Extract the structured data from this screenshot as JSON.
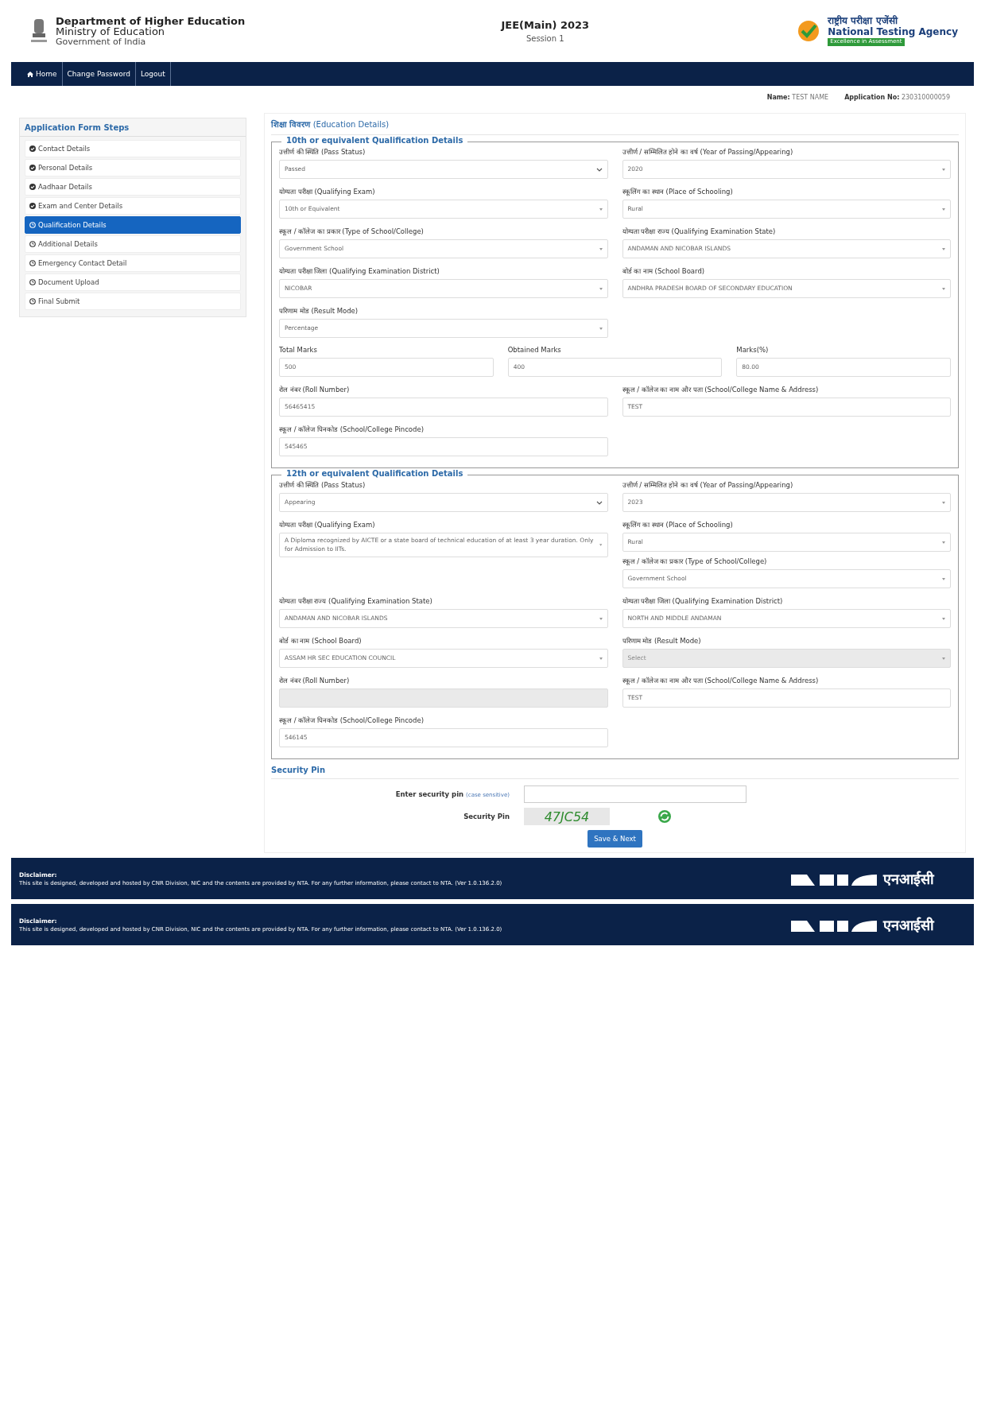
{
  "header": {
    "department": "Department of Higher Education",
    "ministry": "Ministry of Education",
    "government": "Government of India",
    "exam_title": "JEE(Main) 2023",
    "session": "Session 1",
    "agency_hindi": "राष्ट्रीय परीक्षा एजेंसी",
    "agency_name": "National Testing Agency",
    "agency_tagline": "Excellence in Assessment"
  },
  "nav": [
    {
      "label": "Home",
      "kind": "home"
    },
    {
      "label": "Change Password",
      "kind": "link"
    },
    {
      "label": "Logout",
      "kind": "link"
    }
  ],
  "candidate": {
    "name_label": "Name:",
    "name": "TEST NAME",
    "application_label": "Application No:",
    "application_no": "230310000059"
  },
  "sidebar": {
    "title": "Application Form Steps",
    "steps": [
      {
        "label": "Contact Details",
        "done": true,
        "selected": false
      },
      {
        "label": "Personal Details",
        "done": true,
        "selected": false
      },
      {
        "label": "Aadhaar Details",
        "done": true,
        "selected": false
      },
      {
        "label": "Exam and Center Details",
        "done": true,
        "selected": false
      },
      {
        "label": "Qualification Details",
        "done": false,
        "selected": true
      },
      {
        "label": "Additional Details",
        "done": false,
        "selected": false
      },
      {
        "label": "Emergency Contact Detail",
        "done": false,
        "selected": false
      },
      {
        "label": "Document Upload",
        "done": false,
        "selected": false
      },
      {
        "label": "Final Submit",
        "done": false,
        "selected": false
      }
    ]
  },
  "form": {
    "title": "**शिक्षा विवरण** (Education Details)",
    "sections": [
      {
        "title": "10th or equivalent Qualification Details",
        "rows": [
          {
            "columns": [
              [
                {
                  "label": "उत्तीर्ण की स्थिति (Pass Status)",
                  "value": "Passed",
                  "kind": "select",
                  "disabled": false
                }
              ],
              [
                {
                  "label": "उत्तीर्ण / सम्मिलित होने का वर्ष (Year of Passing/Appearing)",
                  "value": "2020",
                  "kind": "picker",
                  "disabled": false
                }
              ]
            ]
          },
          {
            "columns": [
              [
                {
                  "label": "योग्यता परीक्षा (Qualifying Exam)",
                  "value": "10th or Equivalent",
                  "kind": "picker",
                  "disabled": false
                }
              ],
              [
                {
                  "label": "स्कूलिंग का स्थान (Place of Schooling)",
                  "value": "Rural",
                  "kind": "picker",
                  "disabled": false
                }
              ]
            ]
          },
          {
            "columns": [
              [
                {
                  "label": "स्कूल / कॉलेज का प्रकार (Type of School/College)",
                  "value": "Government School",
                  "kind": "picker",
                  "disabled": false
                }
              ],
              [
                {
                  "label": "योग्यता परीक्षा राज्य (Qualifying Examination State)",
                  "value": "ANDAMAN AND NICOBAR ISLANDS",
                  "kind": "picker",
                  "disabled": false
                }
              ]
            ]
          },
          {
            "columns": [
              [
                {
                  "label": "योग्यता परीक्षा जिला (Qualifying Examination District)",
                  "value": "NICOBAR",
                  "kind": "picker",
                  "disabled": false
                }
              ],
              [
                {
                  "label": "बोर्ड का नाम (School Board)",
                  "value": "ANDHRA PRADESH BOARD OF SECONDARY EDUCATION",
                  "kind": "picker",
                  "disabled": false
                }
              ]
            ]
          },
          {
            "columns": [
              [
                {
                  "label": "परिणाम मोड (Result Mode)",
                  "value": "Percentage",
                  "kind": "picker",
                  "disabled": false
                }
              ]
            ]
          },
          {
            "columns": [
              [
                {
                  "label": "Total Marks",
                  "value": "500",
                  "kind": "input",
                  "disabled": false
                }
              ],
              [
                {
                  "label": "Obtained Marks",
                  "value": "400",
                  "kind": "input",
                  "disabled": false
                }
              ],
              [
                {
                  "label": "Marks(%)",
                  "value": "80.00",
                  "kind": "input",
                  "disabled": false
                }
              ]
            ]
          },
          {
            "columns": [
              [
                {
                  "label": "रोल नंबर (Roll Number)",
                  "value": "56465415",
                  "kind": "input",
                  "disabled": false
                }
              ],
              [
                {
                  "label": "स्कूल / कॉलेज का नाम और पता (School/College Name & Address)",
                  "value": "TEST",
                  "kind": "input",
                  "disabled": false
                }
              ]
            ]
          },
          {
            "columns": [
              [
                {
                  "label": "स्कूल / कॉलेज पिनकोड (School/College Pincode)",
                  "value": "545465",
                  "kind": "input",
                  "disabled": false
                }
              ]
            ]
          }
        ]
      },
      {
        "title": "12th or equivalent Qualification Details",
        "rows": [
          {
            "columns": [
              [
                {
                  "label": "उत्तीर्ण की स्थिति (Pass Status)",
                  "value": "Appearing",
                  "kind": "select",
                  "disabled": false
                }
              ],
              [
                {
                  "label": "उत्तीर्ण / सम्मिलित होने का वर्ष (Year of Passing/Appearing)",
                  "value": "2023",
                  "kind": "picker",
                  "disabled": false
                }
              ]
            ]
          },
          {
            "columns": [
              [
                {
                  "label": "योग्यता परीक्षा (Qualifying Exam)",
                  "value": "A Diploma recognized by AICTE or a state board of technical education of at least 3 year duration. Only for Admission to IITs.",
                  "kind": "picker",
                  "disabled": false
                }
              ],
              [
                {
                  "label": "स्कूलिंग का स्थान (Place of Schooling)",
                  "value": "Rural",
                  "kind": "picker",
                  "disabled": false
                },
                {
                  "label": "स्कूल / कॉलेज का प्रकार (Type of School/College)",
                  "value": "Government School",
                  "kind": "picker",
                  "disabled": false
                }
              ]
            ]
          },
          {
            "columns": [
              [
                {
                  "label": "योग्यता परीक्षा राज्य (Qualifying Examination State)",
                  "value": "ANDAMAN AND NICOBAR ISLANDS",
                  "kind": "picker",
                  "disabled": false
                }
              ],
              [
                {
                  "label": "योग्यता परीक्षा जिला (Qualifying Examination District)",
                  "value": "NORTH AND MIDDLE ANDAMAN",
                  "kind": "picker",
                  "disabled": false
                }
              ]
            ]
          },
          {
            "columns": [
              [
                {
                  "label": "बोर्ड का नाम (School Board)",
                  "value": "ASSAM HR SEC EDUCATION COUNCIL",
                  "kind": "picker",
                  "disabled": false
                }
              ],
              [
                {
                  "label": "परिणाम मोड (Result Mode)",
                  "value": "Select",
                  "kind": "picker",
                  "disabled": true
                }
              ]
            ]
          },
          {
            "columns": [
              [
                {
                  "label": "रोल नंबर (Roll Number)",
                  "kind": "input",
                  "disabled": true
                }
              ],
              [
                {
                  "label": "स्कूल / कॉलेज का नाम और पता (School/College Name & Address)",
                  "value": "TEST",
                  "kind": "input",
                  "disabled": false
                }
              ]
            ]
          },
          {
            "columns": [
              [
                {
                  "label": "स्कूल / कॉलेज पिनकोड (School/College Pincode)",
                  "value": "546145",
                  "kind": "input",
                  "disabled": false
                }
              ]
            ]
          }
        ]
      }
    ]
  },
  "security": {
    "title": "Security Pin",
    "pin_label": "Enter security pin",
    "pin_hint": "(case sensitive)",
    "captcha_label": "Security Pin",
    "captcha": "47JC54",
    "submit": "Save & Next"
  },
  "footers": [
    {
      "title": "Disclaimer:",
      "text": "This site is designed, developed and hosted by CNR Division, NIC and the contents are provided by NTA. For any further information, please contact to NTA. (Ver 1.0.136.2.0)",
      "logo_text": "एनआईसी"
    },
    {
      "title": "Disclaimer:",
      "text": "This site is designed, developed and hosted by CNR Division, NIC and the contents are provided by NTA. For any further information, please contact to NTA. (Ver 1.0.136.2.0)",
      "logo_text": "एनआईसी"
    }
  ]
}
